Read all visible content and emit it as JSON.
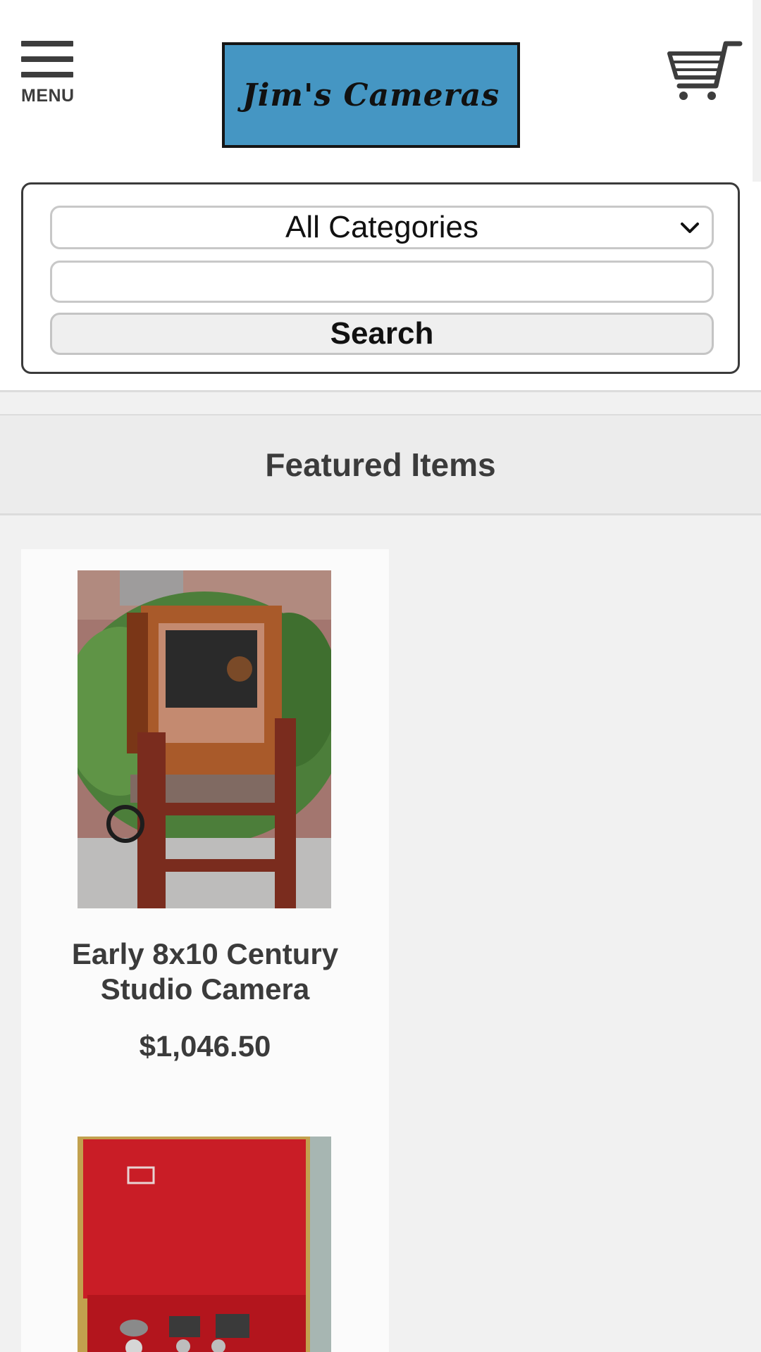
{
  "header": {
    "menu_label": "MENU",
    "logo_text": "Jim's Cameras",
    "cart_icon": "shopping-cart-icon",
    "logo_color": "#4596c3"
  },
  "search": {
    "category_selected": "All Categories",
    "query_value": "",
    "button_label": "Search"
  },
  "featured": {
    "title": "Featured Items",
    "items": [
      {
        "name": "Early 8x10 Century Studio Camera",
        "price": "$1,046.50"
      },
      {
        "name": "",
        "price": ""
      }
    ]
  },
  "colors": {
    "text_dark": "#3b3b3b",
    "page_bg": "#f1f1f1"
  }
}
